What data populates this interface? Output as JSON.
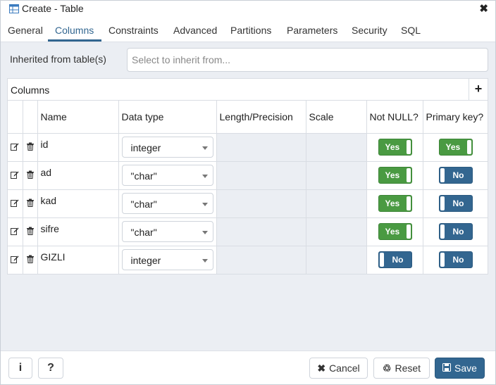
{
  "window": {
    "title": "Create - Table",
    "close_glyph": "✖"
  },
  "tabs": [
    {
      "label": "General"
    },
    {
      "label": "Columns",
      "active": true
    },
    {
      "label": "Constraints"
    },
    {
      "label": "Advanced"
    },
    {
      "label": "Partitions"
    },
    {
      "label": "Parameters"
    },
    {
      "label": "Security"
    },
    {
      "label": "SQL"
    }
  ],
  "inherit": {
    "label": "Inherited from table(s)",
    "placeholder": "Select to inherit from..."
  },
  "columns_panel": {
    "title": "Columns",
    "add_glyph": "+",
    "headers": {
      "name": "Name",
      "data_type": "Data type",
      "length": "Length/Precision",
      "scale": "Scale",
      "not_null": "Not NULL?",
      "primary_key": "Primary key?"
    },
    "rows": [
      {
        "name": "id",
        "data_type": "integer",
        "not_null": "Yes",
        "primary_key": "Yes"
      },
      {
        "name": "ad",
        "data_type": "\"char\"",
        "not_null": "Yes",
        "primary_key": "No"
      },
      {
        "name": "kad",
        "data_type": "\"char\"",
        "not_null": "Yes",
        "primary_key": "No"
      },
      {
        "name": "sifre",
        "data_type": "\"char\"",
        "not_null": "Yes",
        "primary_key": "No"
      },
      {
        "name": "GIZLI",
        "data_type": "integer",
        "not_null": "No",
        "primary_key": "No"
      }
    ]
  },
  "footer": {
    "info_glyph": "i",
    "help_glyph": "?",
    "cancel": {
      "glyph": "✖",
      "label": "Cancel"
    },
    "reset": {
      "glyph": "♲",
      "label": "Reset"
    },
    "save": {
      "glyph": "🖫",
      "label": "Save"
    }
  },
  "colors": {
    "accent": "#326690",
    "toggle_on": "#4a9a42",
    "toggle_off": "#336690"
  },
  "icons": [
    "table-icon",
    "close-icon",
    "plus-icon",
    "edit-icon",
    "trash-icon",
    "caret-down-icon",
    "info-icon",
    "help-icon",
    "cancel-icon",
    "recycle-icon",
    "save-icon"
  ]
}
